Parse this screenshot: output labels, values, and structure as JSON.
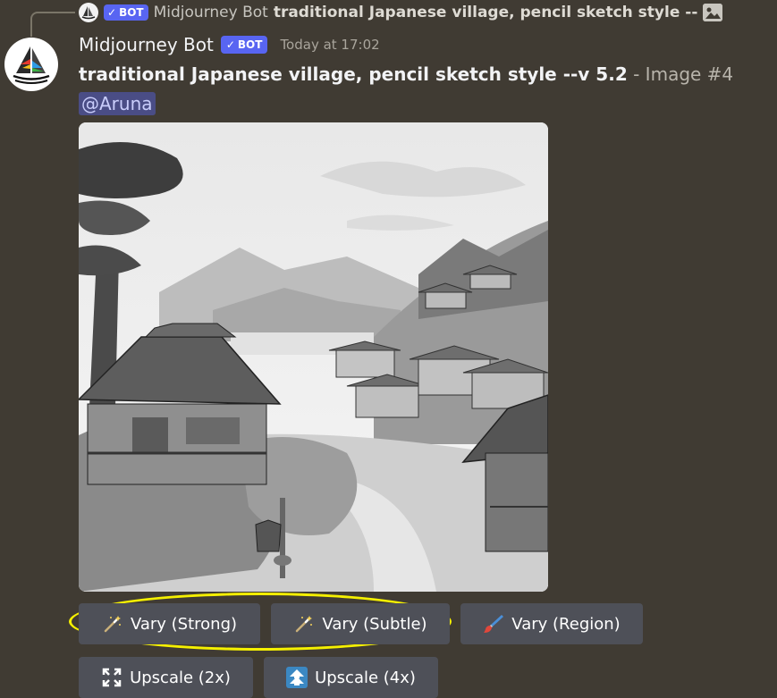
{
  "reply": {
    "author": "Midjourney Bot",
    "badge": "BOT",
    "preview": "traditional Japanese village, pencil sketch style --"
  },
  "message": {
    "author": "Midjourney Bot",
    "badge": "BOT",
    "timestamp": "Today at 17:02",
    "prompt": "traditional Japanese village, pencil sketch style --v 5.2",
    "suffix": " - Image #4",
    "mention": "@Aruna"
  },
  "buttons": {
    "vary_strong": "Vary (Strong)",
    "vary_subtle": "Vary (Subtle)",
    "vary_region": "Vary (Region)",
    "upscale_2x": "Upscale (2x)",
    "upscale_4x": "Upscale (4x)"
  },
  "icons": {
    "vary_strong": "magic-wand-icon",
    "vary_subtle": "magic-wand-icon",
    "vary_region": "paintbrush-icon",
    "upscale_2x": "expand-icon",
    "upscale_4x": "upscale-arrow-icon"
  },
  "colors": {
    "background": "#403b33",
    "bot_badge": "#5865f2",
    "button": "#4e5058",
    "mention_bg": "#4a4d86",
    "highlight": "#f5f000"
  }
}
